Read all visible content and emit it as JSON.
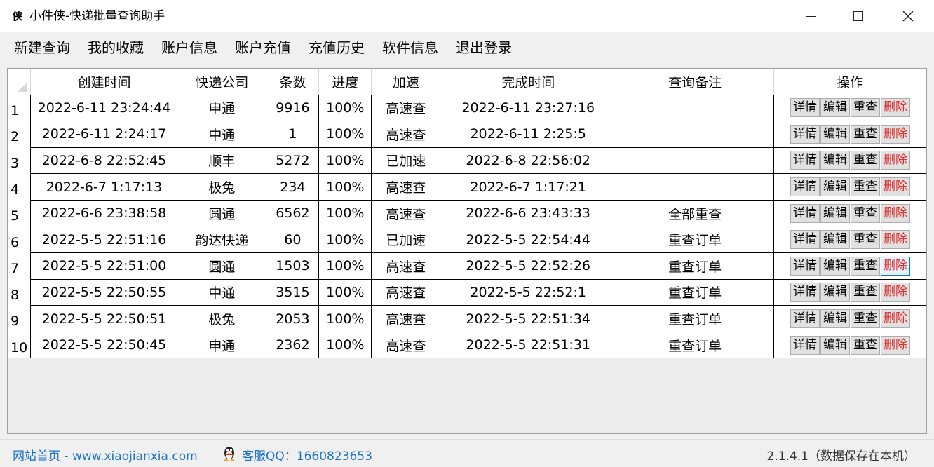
{
  "window": {
    "icon_glyph": "侠",
    "title": "小件侠-快递批量查询助手"
  },
  "menu": {
    "items": [
      "新建查询",
      "我的收藏",
      "账户信息",
      "账户充值",
      "充值历史",
      "软件信息",
      "退出登录"
    ]
  },
  "table": {
    "columns": [
      "创建时间",
      "快递公司",
      "条数",
      "进度",
      "加速",
      "完成时间",
      "查询备注",
      "操作"
    ],
    "rows": [
      {
        "num": "1",
        "created": "2022-6-11 23:24:44",
        "company": "申通",
        "count": "9916",
        "progress": "100%",
        "speed": "高速查",
        "done": "2022-6-11 23:27:16",
        "note": ""
      },
      {
        "num": "2",
        "created": "2022-6-11 2:24:17",
        "company": "中通",
        "count": "1",
        "progress": "100%",
        "speed": "高速查",
        "done": "2022-6-11 2:25:5",
        "note": ""
      },
      {
        "num": "3",
        "created": "2022-6-8 22:52:45",
        "company": "顺丰",
        "count": "5272",
        "progress": "100%",
        "speed": "已加速",
        "done": "2022-6-8 22:56:02",
        "note": ""
      },
      {
        "num": "4",
        "created": "2022-6-7 1:17:13",
        "company": "极兔",
        "count": "234",
        "progress": "100%",
        "speed": "高速查",
        "done": "2022-6-7 1:17:21",
        "note": ""
      },
      {
        "num": "5",
        "created": "2022-6-6 23:38:58",
        "company": "圆通",
        "count": "6562",
        "progress": "100%",
        "speed": "高速查",
        "done": "2022-6-6 23:43:33",
        "note": "全部重查"
      },
      {
        "num": "6",
        "created": "2022-5-5 22:51:16",
        "company": "韵达快递",
        "count": "60",
        "progress": "100%",
        "speed": "已加速",
        "done": "2022-5-5 22:54:44",
        "note": "重查订单"
      },
      {
        "num": "7",
        "created": "2022-5-5 22:51:00",
        "company": "圆通",
        "count": "1503",
        "progress": "100%",
        "speed": "高速查",
        "done": "2022-5-5 22:52:26",
        "note": "重查订单"
      },
      {
        "num": "8",
        "created": "2022-5-5 22:50:55",
        "company": "中通",
        "count": "3515",
        "progress": "100%",
        "speed": "高速查",
        "done": "2022-5-5 22:52:1",
        "note": "重查订单"
      },
      {
        "num": "9",
        "created": "2022-5-5 22:50:51",
        "company": "极兔",
        "count": "2053",
        "progress": "100%",
        "speed": "高速查",
        "done": "2022-5-5 22:51:34",
        "note": "重查订单"
      },
      {
        "num": "10",
        "created": "2022-5-5 22:50:45",
        "company": "申通",
        "count": "2362",
        "progress": "100%",
        "speed": "高速查",
        "done": "2022-5-5 22:51:31",
        "note": "重查订单"
      }
    ],
    "actions": {
      "detail": "详情",
      "edit": "编辑",
      "requery": "重查",
      "delete": "删除"
    },
    "hovered_delete_row": 7
  },
  "status": {
    "site_link": "网站首页 - www.xiaojianxia.com",
    "qq": "客服QQ：1660823653",
    "version": "2.1.4.1（数据保存在本机）"
  },
  "colors": {
    "link": "#1a73c8",
    "delete_text": "#e03030",
    "hover_bg": "#e5f1fb"
  }
}
